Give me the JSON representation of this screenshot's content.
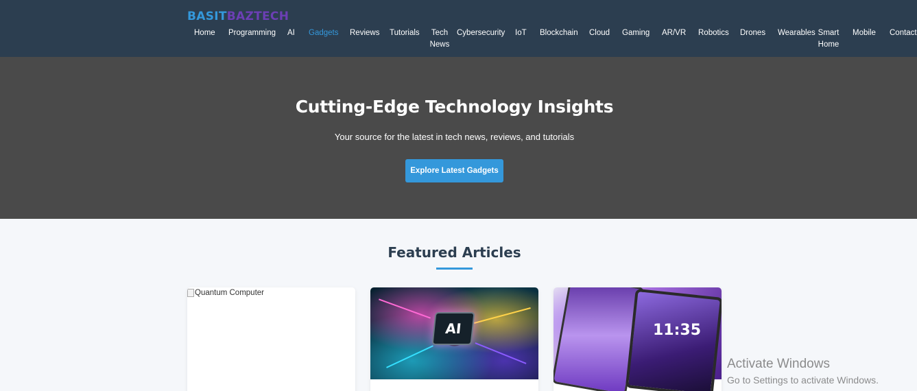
{
  "logo": {
    "part1": "BASIT",
    "part2": "BAZTECH"
  },
  "nav": [
    {
      "label": "Home",
      "active": false
    },
    {
      "label": "Programming",
      "active": false
    },
    {
      "label": "AI",
      "active": false
    },
    {
      "label": "Gadgets",
      "active": true
    },
    {
      "label": "Reviews",
      "active": false
    },
    {
      "label": "Tutorials",
      "active": false
    },
    {
      "label": "Tech News",
      "active": false
    },
    {
      "label": "Cybersecurity",
      "active": false
    },
    {
      "label": "IoT",
      "active": false
    },
    {
      "label": "Blockchain",
      "active": false
    },
    {
      "label": "Cloud",
      "active": false
    },
    {
      "label": "Gaming",
      "active": false
    },
    {
      "label": "AR/VR",
      "active": false
    },
    {
      "label": "Robotics",
      "active": false
    },
    {
      "label": "Drones",
      "active": false
    },
    {
      "label": "Wearables",
      "active": false
    },
    {
      "label": "Smart Home",
      "active": false
    },
    {
      "label": "Mobile",
      "active": false
    },
    {
      "label": "Contact",
      "active": false
    }
  ],
  "hero": {
    "title": "Cutting-Edge Technology Insights",
    "subtitle": "Your source for the latest in tech news, reviews, and tutorials",
    "button": "Explore Latest Gadgets"
  },
  "featured": {
    "title": "Featured Articles",
    "cards": [
      {
        "alt": "Quantum Computer",
        "image": "broken-image"
      },
      {
        "chip_text": "AI",
        "image": "ai-chip-image"
      },
      {
        "time_text": "11:35",
        "image": "tablet-image"
      }
    ]
  },
  "watermark": {
    "line1": "Activate Windows",
    "line2": "Go to Settings to activate Windows."
  },
  "colors": {
    "header": "#2c3e50",
    "accent": "#3498db",
    "hero": "#4a4a4a",
    "logo_secondary": "#6c3fb5"
  }
}
